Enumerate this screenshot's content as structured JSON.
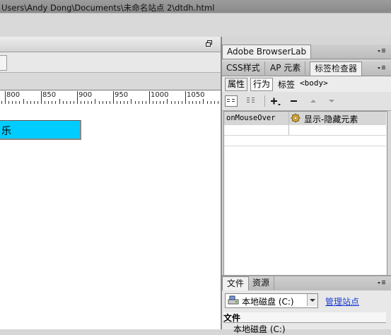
{
  "document": {
    "path": "Users\\Andy Dong\\Documents\\未命名站点 2\\dtdh.html",
    "ruler_ticks": [
      "800",
      "850",
      "900",
      "950",
      "1000",
      "1050"
    ],
    "canvas_text": "乐"
  },
  "panels": {
    "browserlab": {
      "title": "Adobe BrowserLab"
    },
    "tag_group": {
      "tabs": [
        "CSS样式",
        "AP 元素",
        "标签检查器"
      ],
      "active_tab": "标签检查器",
      "sub_tabs": [
        "属性",
        "行为"
      ],
      "active_sub_tab": "行为",
      "tag_label": "标签",
      "tag_value": "<body>",
      "behaviors": [
        {
          "event": "onMouseOver",
          "action": "显示-隐藏元素"
        }
      ]
    },
    "files": {
      "tabs": [
        "文件",
        "资源"
      ],
      "active_tab": "文件",
      "drive": "本地磁盘 (C:)",
      "manage_link": "管理站点",
      "header": "文件",
      "row": "本地磁盘 (C:)"
    }
  },
  "colors": {
    "accent_box": "#00ccff",
    "link": "#1c3fd1"
  }
}
